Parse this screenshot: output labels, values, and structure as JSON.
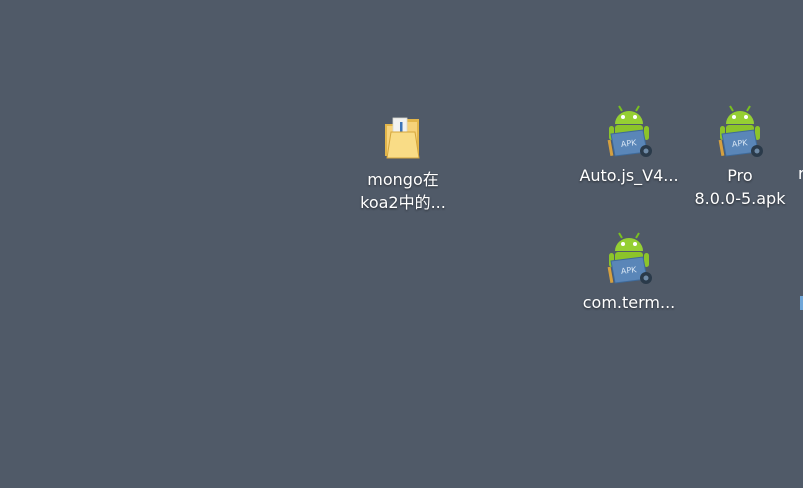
{
  "desktop": {
    "background_color": "#505a68",
    "icons": [
      {
        "name": "folder-icon",
        "label": "mongo在\nkoa2中的..."
      },
      {
        "name": "apk-file-icon",
        "label": "Auto.js_V4..."
      },
      {
        "name": "apk-file-icon",
        "label": "Pro\n8.0.0-5.apk"
      },
      {
        "name": "apk-file-icon",
        "label": "com.term..."
      }
    ],
    "edge_fragment_text": "r"
  }
}
